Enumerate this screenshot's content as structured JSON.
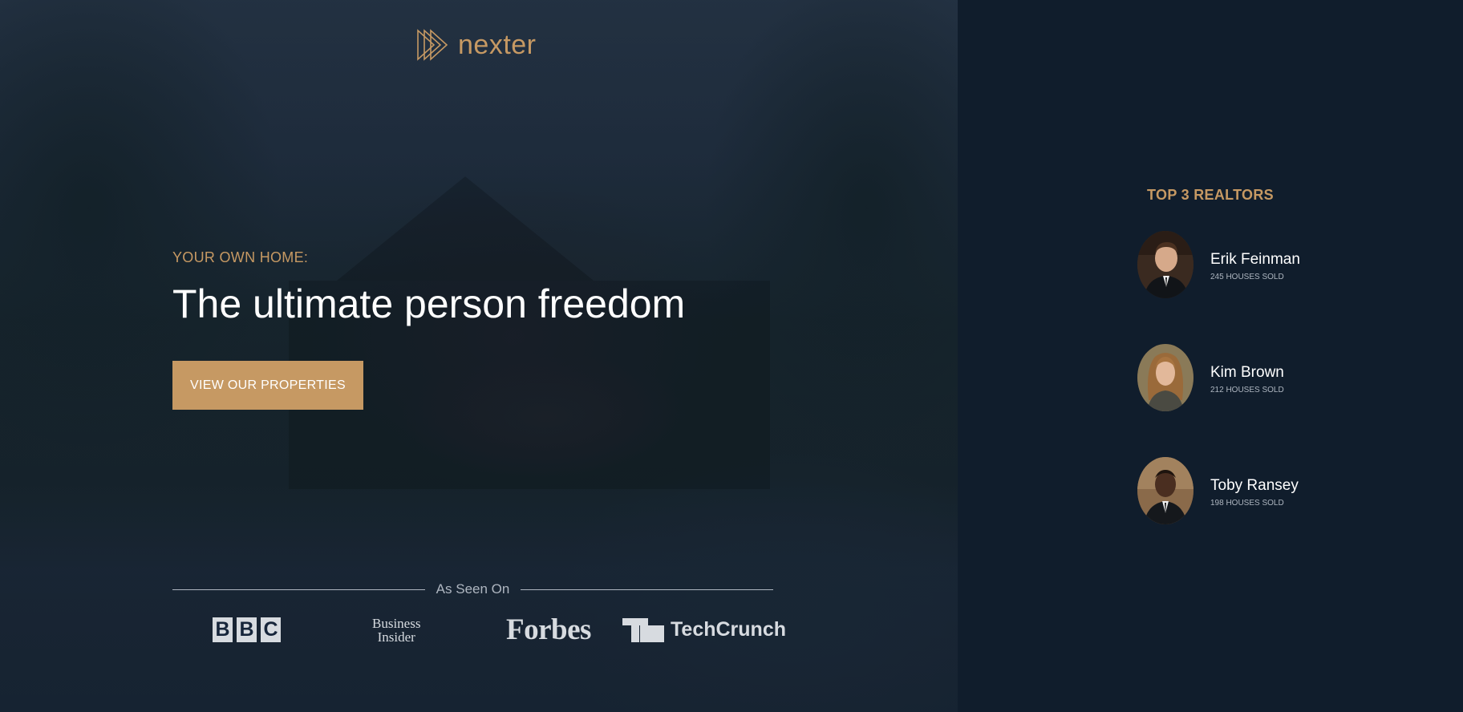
{
  "brand": {
    "name": "nexter",
    "logo_icon": "play-triangles-icon",
    "accent_color": "#c69963"
  },
  "hero": {
    "subtitle": "Your own home:",
    "title": "The ultimate person freedom",
    "cta_label": "View our properties",
    "background_color": "#101d2c"
  },
  "seen_on": {
    "label": "As Seen On",
    "logos": [
      {
        "name": "BBC",
        "letters": [
          "B",
          "B",
          "C"
        ]
      },
      {
        "name": "Business Insider",
        "lines": [
          "Business",
          "Insider"
        ]
      },
      {
        "name": "Forbes",
        "text": "Forbes"
      },
      {
        "name": "TechCrunch",
        "text": "TechCrunch",
        "icon": "techcrunch-tc-icon"
      }
    ]
  },
  "realtors": {
    "title": "Top 3 Realtors",
    "items": [
      {
        "name": "Erik Feinman",
        "sold": "245 Houses Sold",
        "avatar": "man-in-suit"
      },
      {
        "name": "Kim Brown",
        "sold": "212 Houses Sold",
        "avatar": "woman-long-hair"
      },
      {
        "name": "Toby Ransey",
        "sold": "198 Houses Sold",
        "avatar": "man-in-suit"
      }
    ]
  }
}
